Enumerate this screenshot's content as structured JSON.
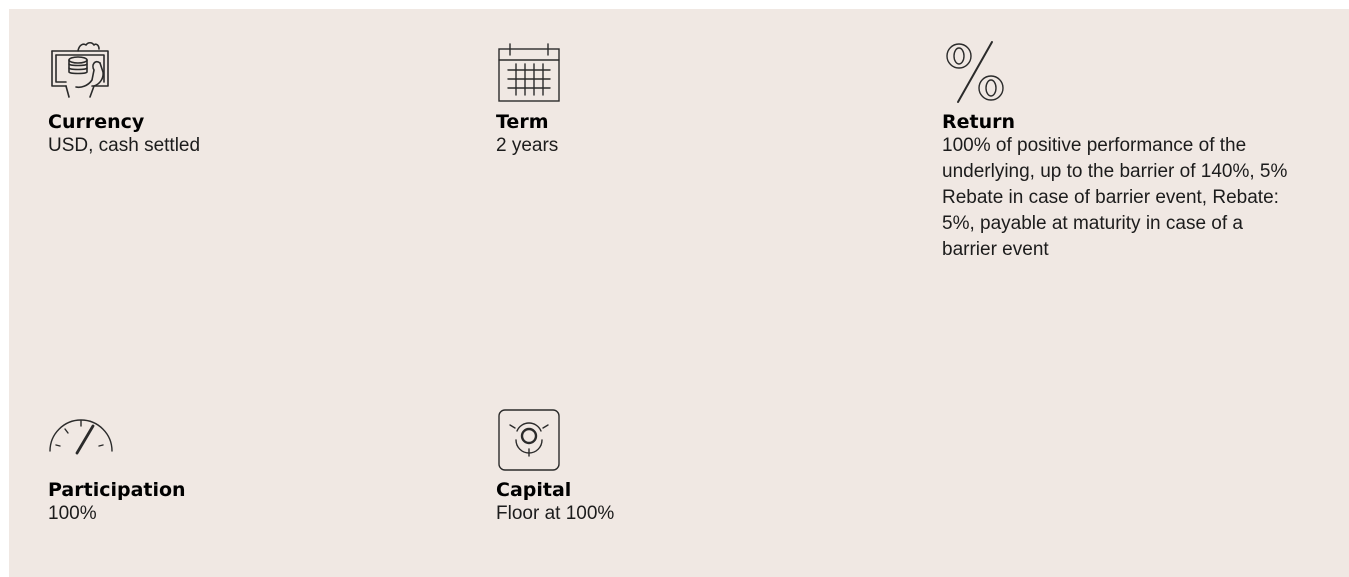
{
  "items": [
    {
      "icon": "cash-in-hand-icon",
      "title": "Currency",
      "value": "USD, cash settled"
    },
    {
      "icon": "calendar-icon",
      "title": "Term",
      "value": "2 years"
    },
    {
      "icon": "percent-icon",
      "title": "Return",
      "value": "100% of positive performance of the underlying, up to the barrier of 140%, 5% Rebate in case of barrier event, Rebate: 5%, payable at maturity in case of a barrier event"
    },
    {
      "icon": "gauge-icon",
      "title": "Participation",
      "value": "100%"
    },
    {
      "icon": "safe-icon",
      "title": "Capital",
      "value": "Floor at 100%"
    }
  ],
  "colors": {
    "background": "#f0e8e3",
    "text": "#000000",
    "icon": "#2b2b2b"
  }
}
